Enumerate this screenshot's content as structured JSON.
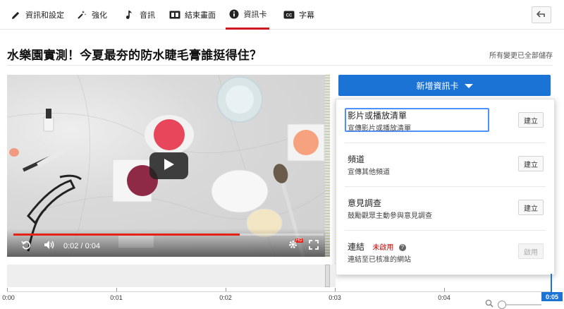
{
  "tabs": [
    {
      "label": "資訊和設定",
      "icon": "pencil-icon"
    },
    {
      "label": "強化",
      "icon": "magic-wand-icon"
    },
    {
      "label": "音訊",
      "icon": "music-note-icon"
    },
    {
      "label": "結束畫面",
      "icon": "end-screen-icon"
    },
    {
      "label": "資訊卡",
      "icon": "info-icon",
      "active": true
    },
    {
      "label": "字幕",
      "icon": "cc-icon"
    }
  ],
  "undo_icon": "undo-arrow-icon",
  "video_title": "水樂園實測！今夏最夯的防水睫毛膏誰挺得住？",
  "save_status": "所有變更已全部儲存",
  "player": {
    "current_time": "0:02",
    "duration": "0:04",
    "progress": 0.73,
    "hd_badge": "HD"
  },
  "add_card_button": {
    "label": "新增資訊卡"
  },
  "card_types": [
    {
      "title": "影片或播放清單",
      "desc": "宣傳影片或播放清單",
      "button": "建立"
    },
    {
      "title": "頻道",
      "desc": "宣傳其他頻道",
      "button": "建立"
    },
    {
      "title": "意見調查",
      "desc": "鼓勵觀眾主動參與意見調查",
      "button": "建立"
    },
    {
      "title": "連結",
      "badge": "未啟用",
      "desc": "連結至已核准的網站",
      "button": "啟用"
    }
  ],
  "timeline": {
    "ticks": [
      "0:00",
      "0:01",
      "0:02",
      "0:03",
      "0:04"
    ],
    "playhead_label": "0:05"
  },
  "accent_color": "#1b73d6",
  "active_tab_color": "#cc181e"
}
